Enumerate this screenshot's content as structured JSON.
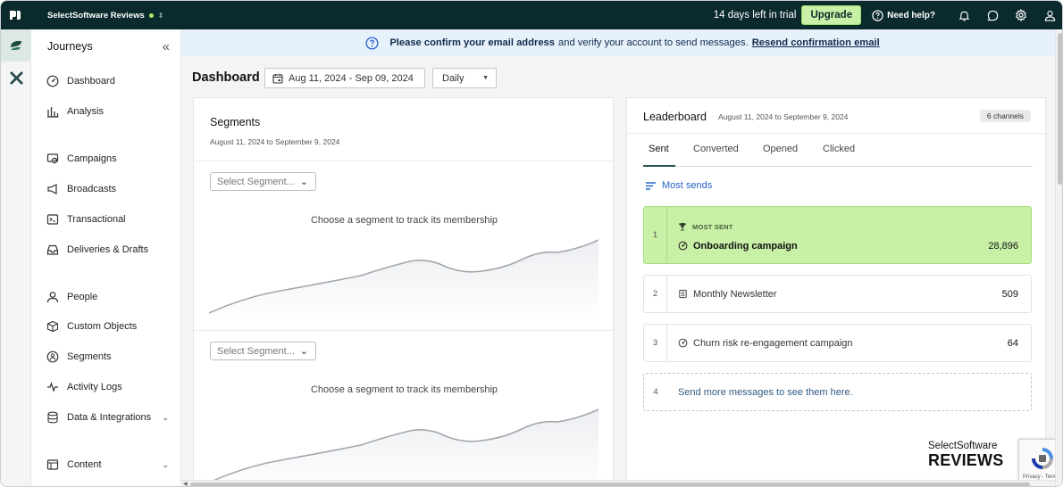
{
  "topbar": {
    "workspace": "SelectSoftware Reviews",
    "trial_text": "14 days left in trial",
    "upgrade_label": "Upgrade",
    "help_label": "Need help?"
  },
  "sidebar": {
    "title": "Journeys",
    "items": [
      {
        "label": "Dashboard",
        "icon": "dashboard-icon"
      },
      {
        "label": "Analysis",
        "icon": "bar-chart-icon"
      },
      {
        "label": "Campaigns",
        "icon": "campaign-icon"
      },
      {
        "label": "Broadcasts",
        "icon": "megaphone-icon"
      },
      {
        "label": "Transactional",
        "icon": "terminal-icon"
      },
      {
        "label": "Deliveries & Drafts",
        "icon": "inbox-icon"
      },
      {
        "label": "People",
        "icon": "person-icon"
      },
      {
        "label": "Custom Objects",
        "icon": "cube-icon"
      },
      {
        "label": "Segments",
        "icon": "segments-icon"
      },
      {
        "label": "Activity Logs",
        "icon": "activity-icon"
      },
      {
        "label": "Data & Integrations",
        "icon": "database-icon"
      },
      {
        "label": "Content",
        "icon": "content-icon"
      }
    ]
  },
  "banner": {
    "bold_text": "Please confirm your email address",
    "text": "and verify your account to send messages.",
    "link": "Resend confirmation email"
  },
  "dashboard": {
    "title": "Dashboard",
    "date_range": "Aug 11, 2024 - Sep 09, 2024",
    "period": "Daily"
  },
  "segments": {
    "title": "Segments",
    "date_range": "August 11, 2024 to September 9, 2024",
    "select_placeholder": "Select Segment...",
    "empty_text": "Choose a segment to track its membership"
  },
  "leaderboard": {
    "title": "Leaderboard",
    "date_range": "August 11, 2024 to September 9, 2024",
    "channels": "6 channels",
    "tabs": [
      "Sent",
      "Converted",
      "Opened",
      "Clicked"
    ],
    "active_tab": "Sent",
    "sort_label": "Most sends",
    "top_badge": "MOST SENT",
    "rows": [
      {
        "rank": "1",
        "name": "Onboarding campaign",
        "value": "28,896",
        "icon": "campaign-icon"
      },
      {
        "rank": "2",
        "name": "Monthly Newsletter",
        "value": "509",
        "icon": "newsletter-icon"
      },
      {
        "rank": "3",
        "name": "Churn risk re-engagement campaign",
        "value": "64",
        "icon": "campaign-icon"
      },
      {
        "rank": "4",
        "name": "Send more messages to see them here.",
        "value": ""
      }
    ]
  },
  "brand": {
    "line1": "SelectSoftware",
    "line2": "REVIEWS"
  },
  "captcha": {
    "text": "Privacy - Terms"
  },
  "colors": {
    "topbar_bg": "#0b2a2e",
    "upgrade_bg": "#c8f0a6",
    "banner_bg": "#e7f1fc",
    "link_blue": "#2563c9",
    "top_row_bg": "#c8f0a6"
  }
}
